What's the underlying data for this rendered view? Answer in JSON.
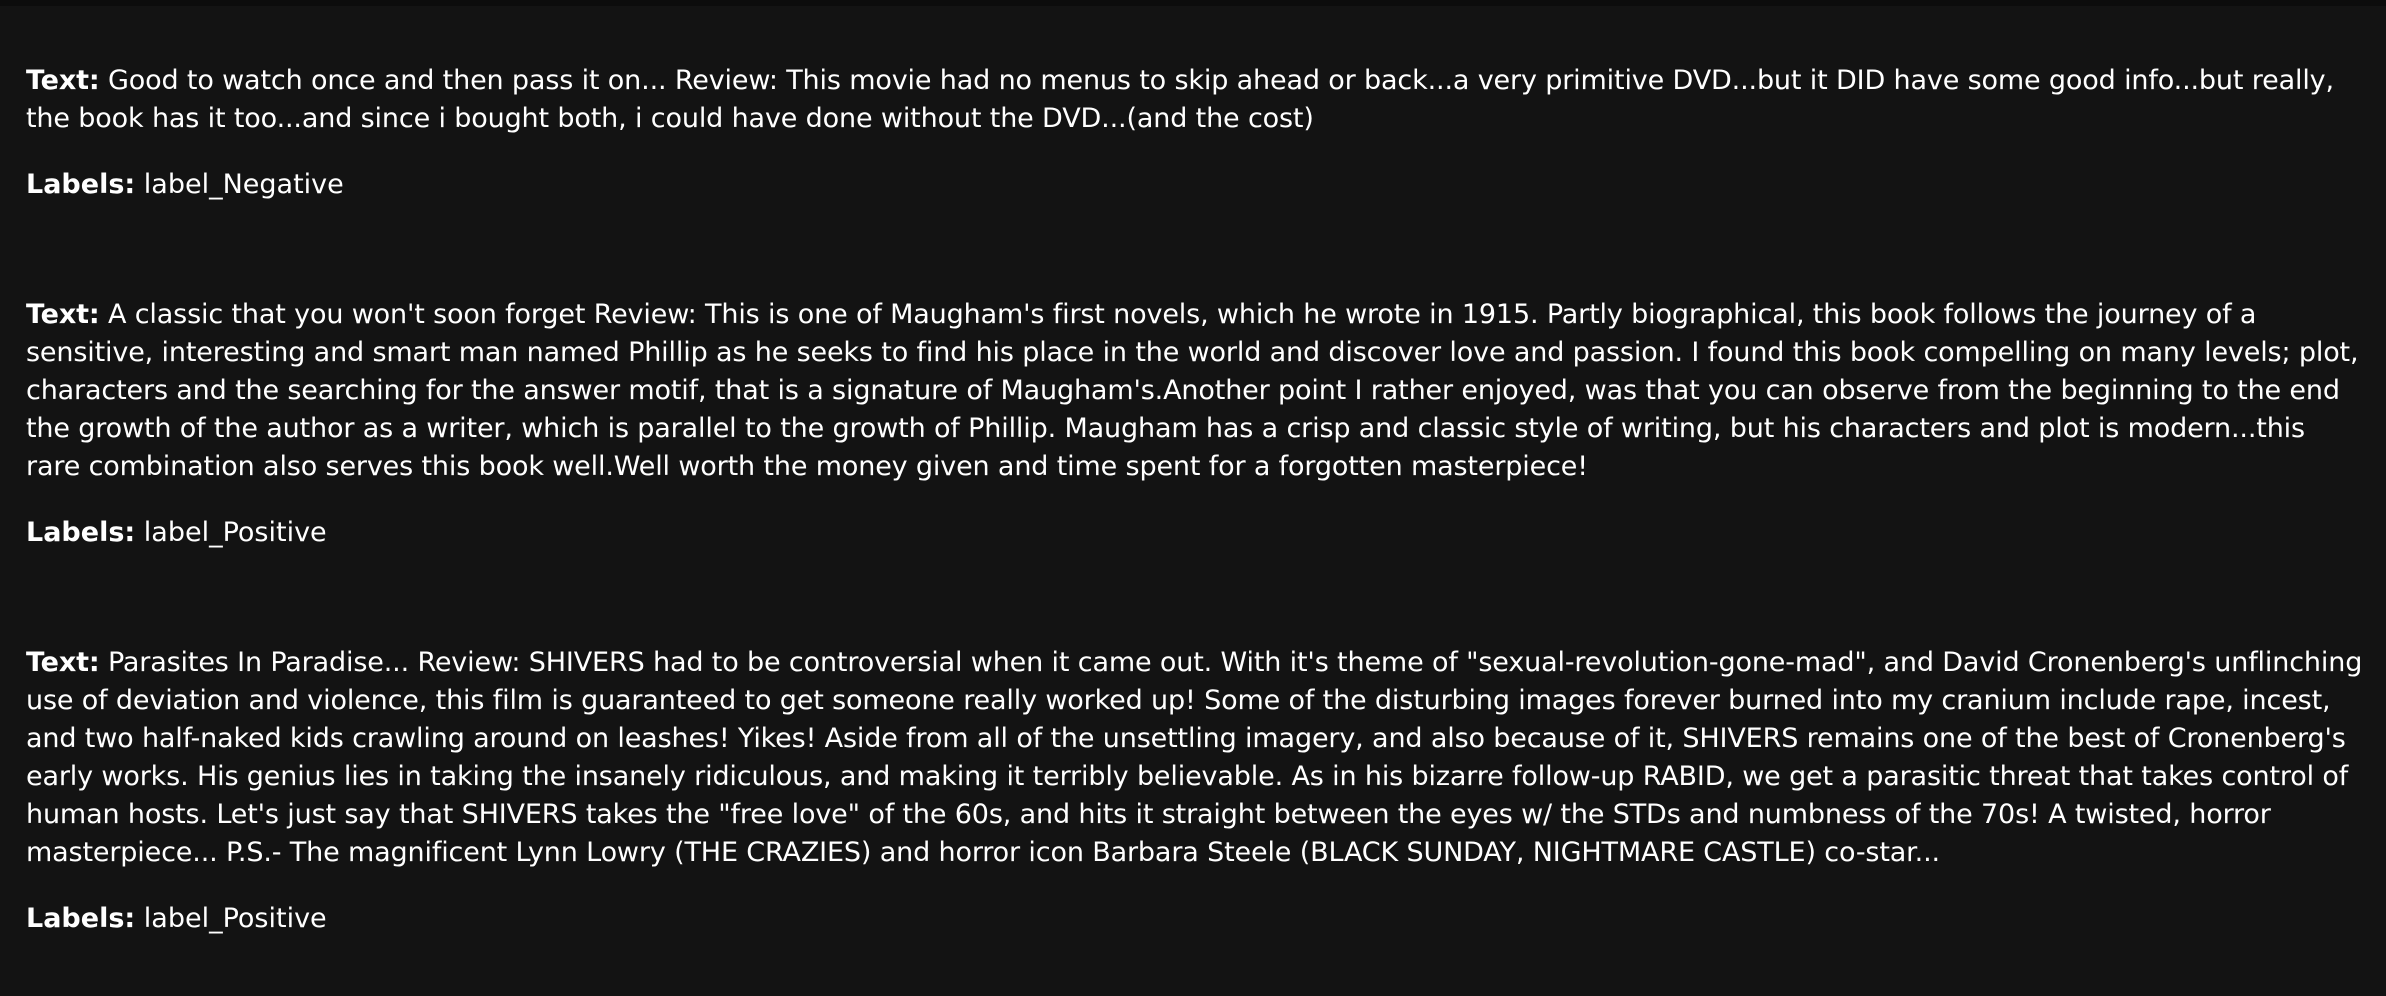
{
  "field_names": {
    "text_key": "Text:",
    "labels_key": "Labels:"
  },
  "records": [
    {
      "text": "Good to watch once and then pass it on... Review: This movie had no menus to skip ahead or back...a very primitive DVD...but it DID have some good info...but really, the book has it too...and since i bought both, i could have done without the DVD...(and the cost)",
      "label": "label_Negative"
    },
    {
      "text": "A classic that you won't soon forget Review: This is one of Maugham's first novels, which he wrote in 1915. Partly biographical, this book follows the journey of a sensitive, interesting and smart man named Phillip as he seeks to find his place in the world and discover love and passion. I found this book compelling on many levels; plot, characters and the searching for the answer motif, that is a signature of Maugham's.Another point I rather enjoyed, was that you can observe from the beginning to the end the growth of the author as a writer, which is parallel to the growth of Phillip. Maugham has a crisp and classic style of writing, but his characters and plot is modern...this rare combination also serves this book well.Well worth the money given and time spent for a forgotten masterpiece!",
      "label": "label_Positive"
    },
    {
      "text": "Parasites In Paradise... Review: SHIVERS had to be controversial when it came out. With it's theme of \"sexual-revolution-gone-mad\", and David Cronenberg's unflinching use of deviation and violence, this film is guaranteed to get someone really worked up! Some of the disturbing images forever burned into my cranium include rape, incest, and two half-naked kids crawling around on leashes! Yikes! Aside from all of the unsettling imagery, and also because of it, SHIVERS remains one of the best of Cronenberg's early works. His genius lies in taking the insanely ridiculous, and making it terribly believable. As in his bizarre follow-up RABID, we get a parasitic threat that takes control of human hosts. Let's just say that SHIVERS takes the \"free love\" of the 60s, and hits it straight between the eyes w/ the STDs and numbness of the 70s! A twisted, horror masterpiece... P.S.- The magnificent Lynn Lowry (THE CRAZIES) and horror icon Barbara Steele (BLACK SUNDAY, NIGHTMARE CASTLE) co-star...",
      "label": "label_Positive"
    }
  ],
  "colors": {
    "background": "#131313",
    "text": "#ffffff"
  }
}
